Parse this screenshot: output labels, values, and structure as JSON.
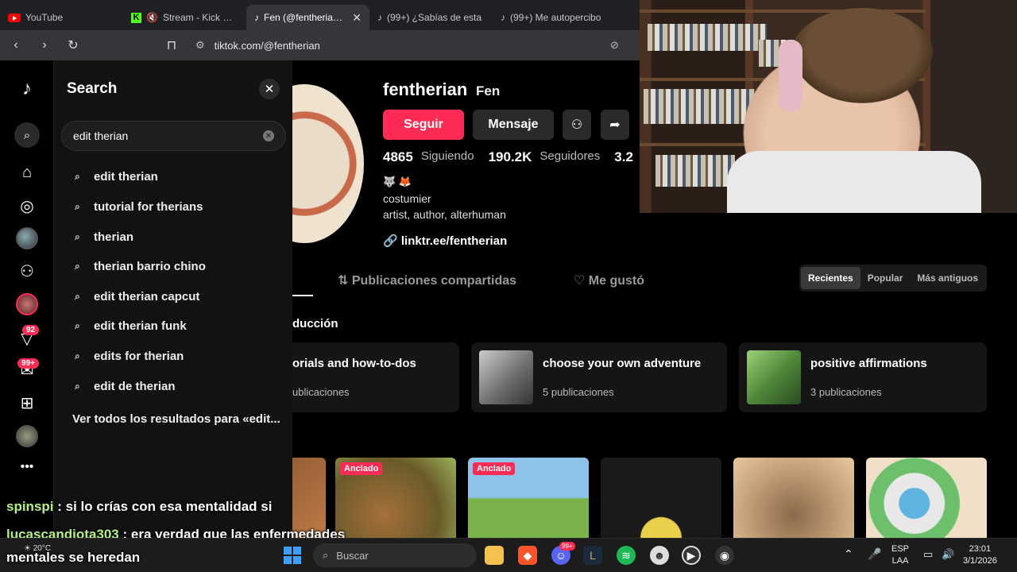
{
  "browser": {
    "tabs": [
      {
        "title": "YouTube",
        "icon": "youtube-icon",
        "active": false
      },
      {
        "title": "Stream - Kick Dashboard",
        "icon": "kick-icon",
        "active": false
      },
      {
        "title": "Fen (@fentherian) | TikTok",
        "icon": "tiktok-icon",
        "active": true
      },
      {
        "title": "(99+) ¿Sabías de esta",
        "icon": "tiktok-icon",
        "active": false
      },
      {
        "title": "(99+) Me autopercibo",
        "icon": "tiktok-icon",
        "active": false
      }
    ],
    "url": "tiktok.com/@fentherian"
  },
  "search": {
    "title": "Search",
    "query": "edit therian",
    "suggestions": [
      "edit therian",
      "tutorial for therians",
      "therian",
      "therian barrio chino",
      "edit therian capcut",
      "edit therian funk",
      "edits for therian",
      "edit de therian"
    ],
    "see_all": "Ver todos los resultados para «edit..."
  },
  "rail": {
    "badge_inbox": "92",
    "badge_messages": "99+"
  },
  "profile": {
    "username": "fentherian",
    "nickname": "Fen",
    "follow_label": "Seguir",
    "message_label": "Mensaje",
    "following_count": "4865",
    "following_label": "Siguiendo",
    "followers_count": "190.2K",
    "followers_label": "Seguidores",
    "likes_count": "3.2",
    "bio_emoji": "🐺 🦊",
    "bio_line1": "costumier",
    "bio_line2": "artist, author, alterhuman",
    "link": "linktr.ee/fentherian"
  },
  "content_tabs": {
    "reposts": "Publicaciones compartidas",
    "liked": "Me gustó",
    "sort_options": [
      "Recientes",
      "Popular",
      "Más antiguos"
    ],
    "sort_selected": "Recientes"
  },
  "collections": {
    "title": "ducción",
    "items": [
      {
        "title": "orials and how-to-dos",
        "count": "ublicaciones"
      },
      {
        "title": "choose your own adventure",
        "count": "5 publicaciones"
      },
      {
        "title": "positive affirmations",
        "count": "3 publicaciones"
      }
    ]
  },
  "videos": {
    "pinned_label": "Anclado"
  },
  "chat": [
    {
      "user": "spinspi",
      "message": ": si lo crías con esa mentalidad si"
    },
    {
      "user": "lucascandiota303",
      "message": ": era verdad que las enfermedades"
    },
    {
      "user": "",
      "message": "mentales se heredan"
    }
  ],
  "taskbar": {
    "weather": "20°C",
    "search_placeholder": "Buscar",
    "lang": "ESP",
    "lang_sub": "LAA",
    "time": "23:01",
    "date": "3/1/2026",
    "discord_badge": "99+"
  },
  "colors": {
    "accent": "#fe2c55",
    "chat_user": "#b6f27a"
  }
}
